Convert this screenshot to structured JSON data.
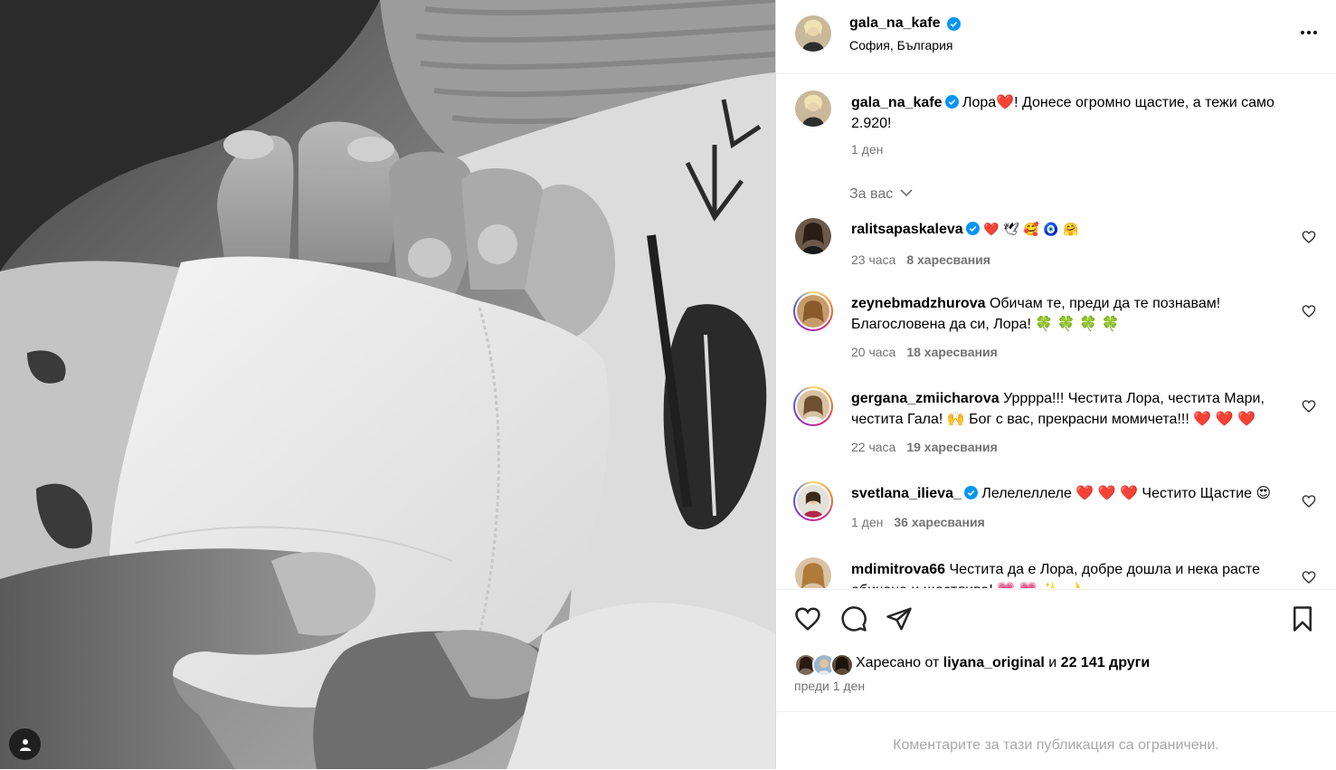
{
  "post": {
    "author": "gala_na_kafe",
    "location": "София, България",
    "caption": "Лора❤️! Донесе огромно щастие, а тежи само 2.920!",
    "caption_time": "1 ден",
    "for_you_label": "За вас"
  },
  "comments": [
    {
      "user": "ralitsapaskaleva",
      "verified": true,
      "text": "❤️ 🕊 🥰 🧿 🤗",
      "time": "23 часа",
      "likes": "8 харесвания"
    },
    {
      "user": "zeynebmadzhurova",
      "verified": false,
      "text": "Обичам те, преди да те познавам! Благословена да си, Лора! 🍀 🍀 🍀 🍀",
      "time": "20 часа",
      "likes": "18 харесвания"
    },
    {
      "user": "gergana_zmiicharova",
      "verified": false,
      "text": "Урррра!!! Честита Лора, честита Мари, честита Гала! 🙌 Бог с вас, прекрасни момичета!!! ❤️ ❤️ ❤️",
      "time": "22 часа",
      "likes": "19 харесвания"
    },
    {
      "user": "svetlana_ilieva_",
      "verified": true,
      "text": "Лелелеллеле ❤️ ❤️ ❤️ Честито Щастие 😍",
      "time": "1 ден",
      "likes": "36 харесвания"
    },
    {
      "user": "mdimitrova66",
      "verified": false,
      "text": "Честита да е Лора, добре дошла и нека расте обичана и щастлива! 💗 💗 ✨ 🌙",
      "time": "",
      "likes": ""
    }
  ],
  "likes": {
    "prefix": "Харесано от",
    "user": "liyana_original",
    "joiner": "и",
    "others": "22 141 други",
    "time_ago": "преди 1 ден"
  },
  "footer": {
    "restricted": "Коментарите за тази публикация са ограничени."
  },
  "colors": {
    "verified": "#0095f6",
    "secondary_text": "#737373",
    "heart_red": "#e0245e"
  },
  "icons": [
    "more-icon",
    "heart-icon",
    "comment-icon",
    "share-icon",
    "save-icon",
    "verified-icon",
    "user-tag-icon",
    "chevron-down-icon"
  ]
}
